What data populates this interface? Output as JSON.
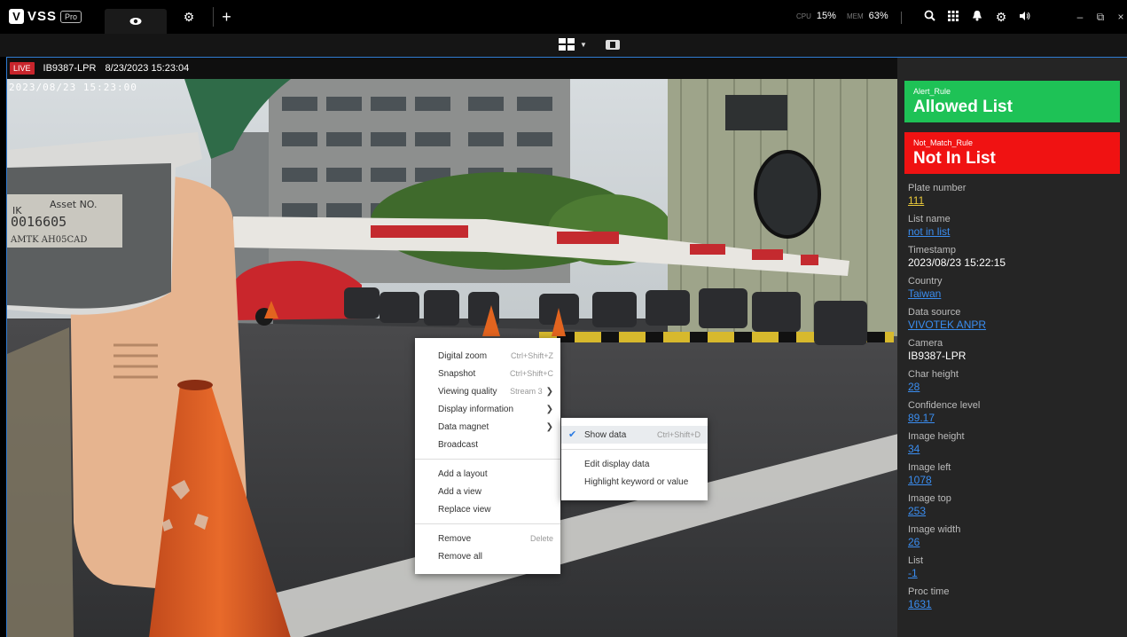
{
  "app": {
    "logo_letter": "V",
    "logo_name": "VSS",
    "logo_edition": "Pro"
  },
  "topbar": {
    "tabs": [
      {
        "icon": "eye-icon"
      },
      {
        "icon": "gear-icon"
      },
      {
        "label": "+"
      }
    ],
    "cpu_label": "CPU",
    "cpu_value": "15%",
    "mem_label": "MEM",
    "mem_value": "63%",
    "icons": [
      "search-icon",
      "grid-menu-icon",
      "bell-icon",
      "gear-icon",
      "volume-icon"
    ],
    "window_controls": {
      "minimize": "–",
      "restore": "⧉",
      "close": "×"
    }
  },
  "toolbar": {
    "layout_icon": "layout-grid-icon",
    "fit_icon": "fit-view-icon"
  },
  "video": {
    "live_badge": "LIVE",
    "camera_title": "IB9387-LPR",
    "camera_datetime": "8/23/2023 15:23:04",
    "osd_timestamp": "2023/08/23 15:23:00",
    "colors": {
      "border_active": "#2f7bd1"
    }
  },
  "rules": [
    {
      "name": "Alert_Rule",
      "result": "Allowed List",
      "color": "#1ec256"
    },
    {
      "name": "Not_Match_Rule",
      "result": "Not In List",
      "color": "#f01212"
    }
  ],
  "fields": [
    {
      "label": "Plate number",
      "value": "111",
      "style": "yellow"
    },
    {
      "label": "List name",
      "value": "not in list",
      "style": "blue"
    },
    {
      "label": "Timestamp",
      "value": "2023/08/23 15:22:15",
      "style": "white"
    },
    {
      "label": "Country",
      "value": "Taiwan",
      "style": "blue"
    },
    {
      "label": "Data source",
      "value": "VIVOTEK ANPR",
      "style": "blue"
    },
    {
      "label": "Camera",
      "value": "IB9387-LPR",
      "style": "white"
    },
    {
      "label": "Char height",
      "value": "28",
      "style": "blue"
    },
    {
      "label": "Confidence level",
      "value": "89.17",
      "style": "blue"
    },
    {
      "label": "Image height",
      "value": "34",
      "style": "blue"
    },
    {
      "label": "Image left",
      "value": "1078",
      "style": "blue"
    },
    {
      "label": "Image top",
      "value": "253",
      "style": "blue"
    },
    {
      "label": "Image width",
      "value": "26",
      "style": "blue"
    },
    {
      "label": "List",
      "value": "-1",
      "style": "blue"
    },
    {
      "label": "Proc time",
      "value": "1631",
      "style": "blue"
    }
  ],
  "context_menu": {
    "items": [
      {
        "label": "Digital zoom",
        "shortcut": "Ctrl+Shift+Z"
      },
      {
        "label": "Snapshot",
        "shortcut": "Ctrl+Shift+C"
      },
      {
        "label": "Viewing quality",
        "shortcut": "Stream 3",
        "submenu": true
      },
      {
        "label": "Display information",
        "submenu": true
      },
      {
        "label": "Data magnet",
        "submenu": true
      },
      {
        "label": "Broadcast"
      },
      {
        "label": "Add a layout"
      },
      {
        "label": "Add a view"
      },
      {
        "label": "Replace view"
      },
      {
        "label": "Remove",
        "shortcut": "Delete"
      },
      {
        "label": "Remove all"
      }
    ]
  },
  "sub_menu": {
    "items": [
      {
        "label": "Show data",
        "shortcut": "Ctrl+Shift+D",
        "checked": true
      },
      {
        "label": "Edit display data"
      },
      {
        "label": "Highlight keyword or value"
      }
    ]
  },
  "scene": {
    "asset_label": "Asset NO.",
    "asset_number": "0016605",
    "asset_model": "AMTK AH05CAD",
    "asset_prefix": "IK"
  }
}
